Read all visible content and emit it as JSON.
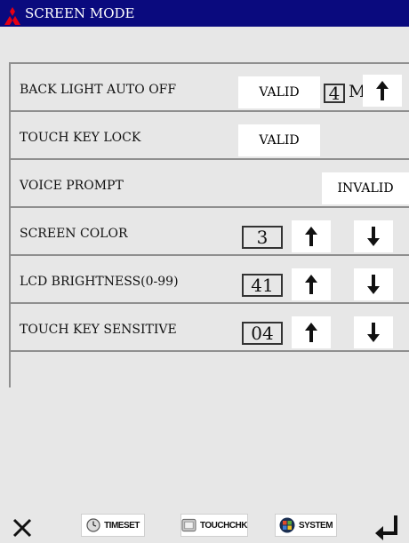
{
  "header": {
    "title": "SCREEN MODE",
    "logo_icon": "mitsubishi-logo-icon",
    "background": "#0a0a7e"
  },
  "rows": {
    "backlight": {
      "label": "BACK LIGHT AUTO OFF",
      "button": "VALID",
      "value": "4",
      "unit": "M"
    },
    "touchlock": {
      "label": "TOUCH KEY LOCK",
      "button": "VALID"
    },
    "voice": {
      "label": "VOICE PROMPT",
      "button": "INVALID"
    },
    "color": {
      "label": "SCREEN COLOR",
      "value": "3"
    },
    "brightness": {
      "label": "LCD BRIGHTNESS(0-99)",
      "value": "41"
    },
    "sensitivity": {
      "label": "TOUCH KEY SENSITIVE",
      "value": "04"
    }
  },
  "footer": {
    "close_icon": "close-icon",
    "timeset": {
      "label": "TIMESET",
      "icon": "clock-icon"
    },
    "touchchk": {
      "label": "TOUCHCHK",
      "icon": "touch-screen-icon"
    },
    "system": {
      "label": "SYSTEM",
      "icon": "windows-logo-icon"
    },
    "enter_icon": "enter-return-icon"
  }
}
